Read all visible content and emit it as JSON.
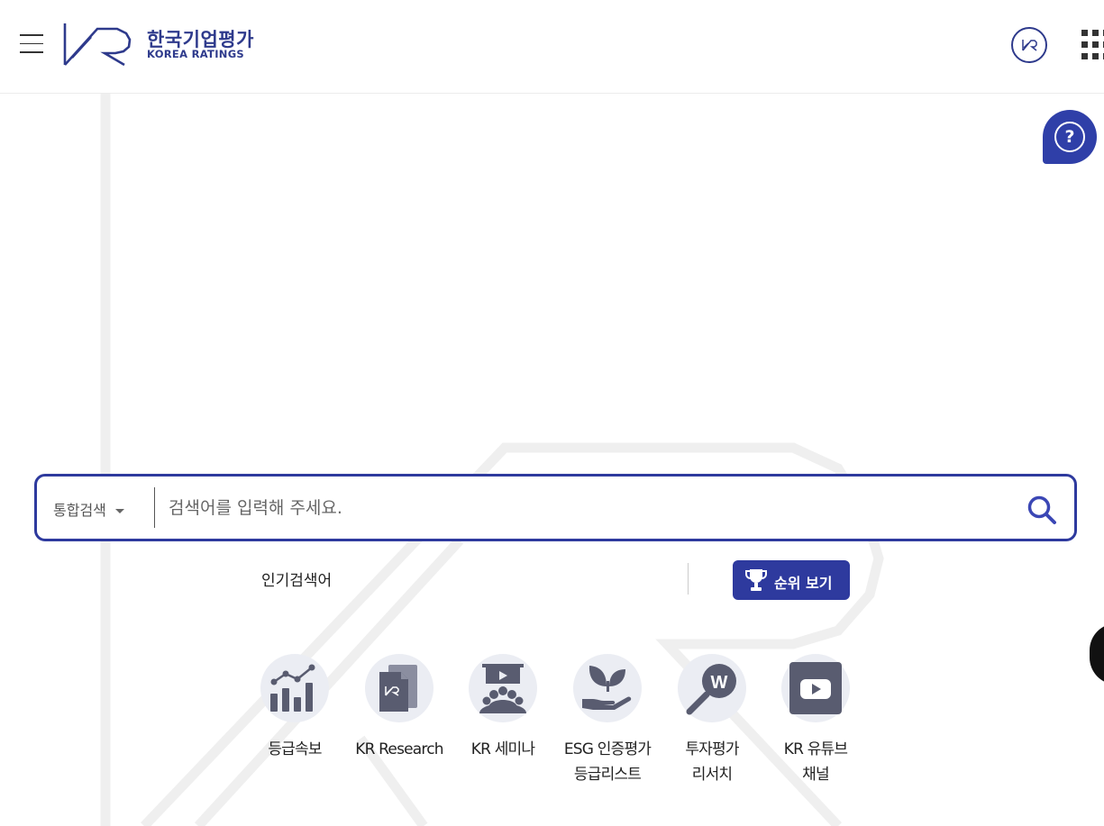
{
  "header": {
    "logo_kr": "한국기업평가",
    "logo_en": "KOREA RATINGS"
  },
  "search": {
    "category": "통합검색",
    "placeholder": "검색어를 입력해 주세요."
  },
  "popular": {
    "label": "인기검색어",
    "rank_button": "순위 보기"
  },
  "quick_links": [
    {
      "label": "등급속보",
      "icon": "rising-bar-chart-icon"
    },
    {
      "label": "KR Research",
      "icon": "kr-document-icon"
    },
    {
      "label": "KR 세미나",
      "icon": "seminar-audience-icon"
    },
    {
      "label": "ESG 인증평가\n등급리스트",
      "icon": "hand-sprout-icon"
    },
    {
      "label": "투자평가\n리서치",
      "icon": "magnifier-w-icon"
    },
    {
      "label": "KR 유튜브\n채널",
      "icon": "youtube-play-icon"
    }
  ],
  "colors": {
    "brand": "#2e3a9e",
    "icon_fill": "#595c70",
    "icon_bg": "#ebedf3"
  }
}
